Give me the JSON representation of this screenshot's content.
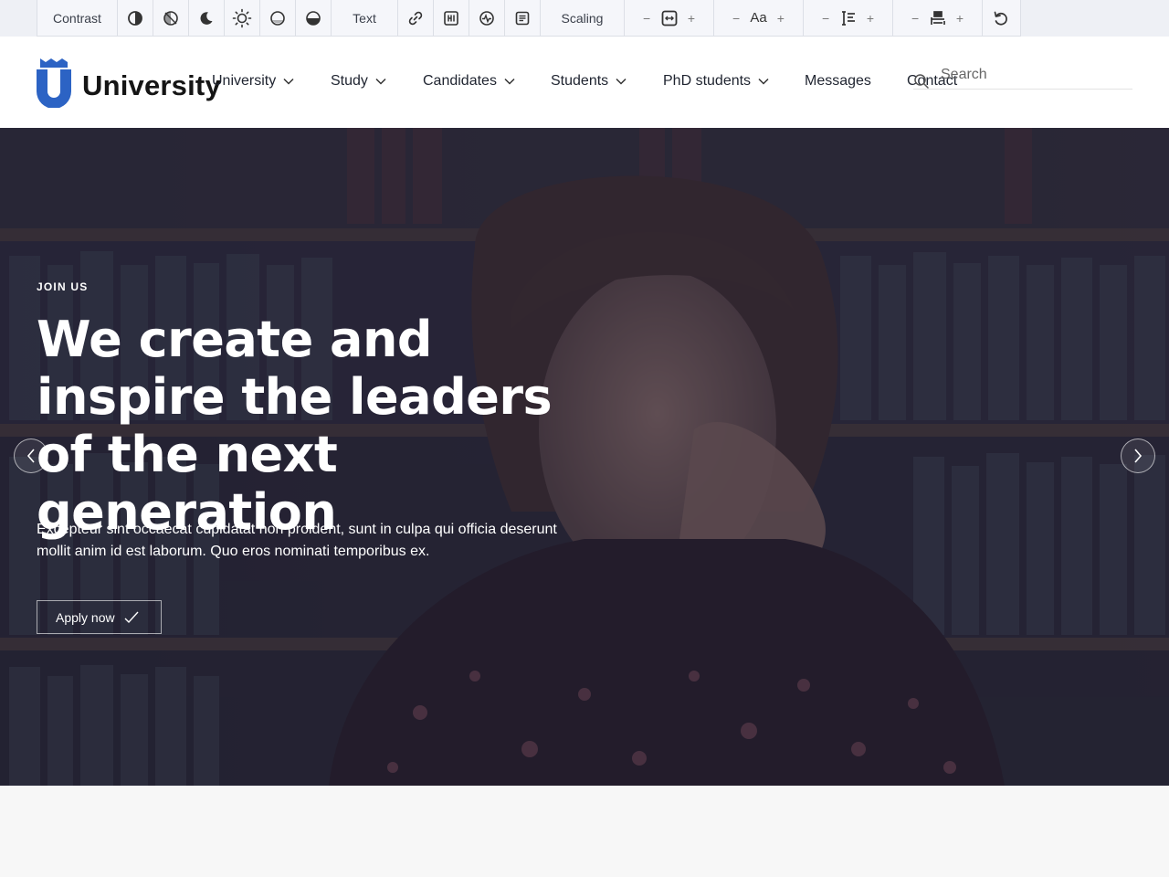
{
  "toolbar": {
    "contrast_label": "Contrast",
    "text_label": "Text",
    "scaling_label": "Scaling",
    "contrast_icons": [
      "contrast-half-icon",
      "invert-colors-icon",
      "dark-mode-moon-icon",
      "light-mode-sun-icon",
      "low-saturation-icon",
      "high-saturation-icon"
    ],
    "text_icons": [
      "highlight-links-icon",
      "highlight-headings-icon",
      "pause-animations-icon",
      "readable-text-icon"
    ],
    "steppers": [
      {
        "name": "scaling",
        "minus": "−",
        "plus": "+",
        "icon": "zoom-frame-icon"
      },
      {
        "name": "font-size",
        "minus": "−",
        "plus": "+",
        "mid": "Aa"
      },
      {
        "name": "line-height",
        "minus": "−",
        "plus": "+",
        "icon": "line-height-icon"
      },
      {
        "name": "letter-spacing",
        "minus": "−",
        "plus": "+",
        "icon": "letter-spacing-icon"
      }
    ],
    "reset_icon": "reset-icon"
  },
  "header": {
    "logo_text": "University",
    "brand_color": "#2c63c4",
    "nav": [
      {
        "label": "University",
        "dropdown": true
      },
      {
        "label": "Study",
        "dropdown": true
      },
      {
        "label": "Candidates",
        "dropdown": true
      },
      {
        "label": "Students",
        "dropdown": true
      },
      {
        "label": "PhD students",
        "dropdown": true
      },
      {
        "label": "Messages",
        "dropdown": false
      },
      {
        "label": "Contact",
        "dropdown": false
      }
    ],
    "search": {
      "placeholder": "Search",
      "value": ""
    }
  },
  "hero": {
    "eyebrow": "JOIN US",
    "title": "We create and inspire the leaders of the next generation",
    "text": "Excepteur sint occaecat cupidatat non proident, sunt in culpa qui officia deserunt mollit anim id est laborum. Quo eros nominati temporibus ex.",
    "cta_label": "Apply now"
  }
}
